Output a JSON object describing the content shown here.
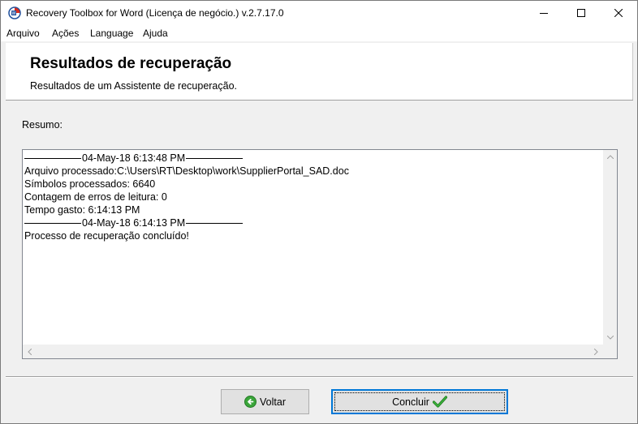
{
  "window": {
    "title": "Recovery Toolbox for Word (Licença de negócio.) v.2.7.17.0"
  },
  "icons": {
    "app": "word-recovery-app-icon",
    "minimize": "minimize-icon",
    "maximize": "maximize-icon",
    "close": "close-icon",
    "back": "green-back-arrow-icon",
    "finish": "green-checkmark-icon"
  },
  "menu": {
    "items": [
      "Arquivo",
      "Ações",
      "Language",
      "Ajuda"
    ]
  },
  "header": {
    "title": "Resultados de recuperação",
    "subtitle": "Resultados de um Assistente de recuperação."
  },
  "summary": {
    "label": "Resumo:",
    "separator_start": "04-May-18 6:13:48 PM",
    "processed_file": "Arquivo processado:C:\\Users\\RT\\Desktop\\work\\SupplierPortal_SAD.doc",
    "symbols": "Símbolos processados: 6640",
    "read_errors": "Contagem de erros de leitura: 0",
    "time_spent": "Tempo gasto: 6:14:13 PM",
    "separator_end": "04-May-18 6:14:13 PM",
    "done": "Processo de recuperação concluído!"
  },
  "buttons": {
    "back": "Voltar",
    "finish": "Concluir"
  },
  "colors": {
    "accent": "#0078d7",
    "check_green": "#2f9e2f"
  }
}
